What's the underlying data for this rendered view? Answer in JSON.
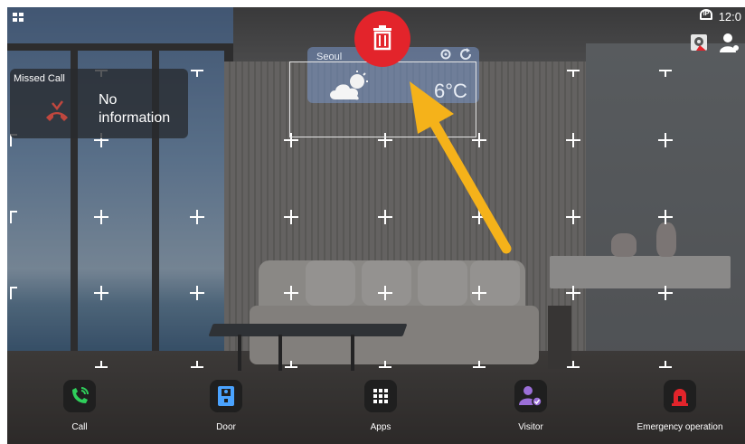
{
  "status_bar": {
    "time": "12:0",
    "ip_icon": "ip-icon",
    "ip_label": "IP"
  },
  "missed_call": {
    "title": "Missed Call",
    "text": "No information"
  },
  "weather": {
    "city": "Seoul",
    "temperature": "6°C",
    "icon": "cloud-sun-icon"
  },
  "delete": {
    "icon": "trash-icon",
    "color": "#e3242b"
  },
  "annotation": {
    "arrow_color": "#f5b21a"
  },
  "dock": {
    "items": [
      {
        "label": "Call",
        "icon": "phone-icon",
        "color": "#2fcf5b"
      },
      {
        "label": "Door",
        "icon": "door-icon",
        "color": "#4aa3ff"
      },
      {
        "label": "Apps",
        "icon": "apps-grid-icon",
        "color": "#ffffff"
      },
      {
        "label": "Visitor",
        "icon": "visitor-icon",
        "color": "#9b6fd8"
      },
      {
        "label": "Emergency operation",
        "icon": "alarm-icon",
        "color": "#e3242b"
      }
    ]
  }
}
